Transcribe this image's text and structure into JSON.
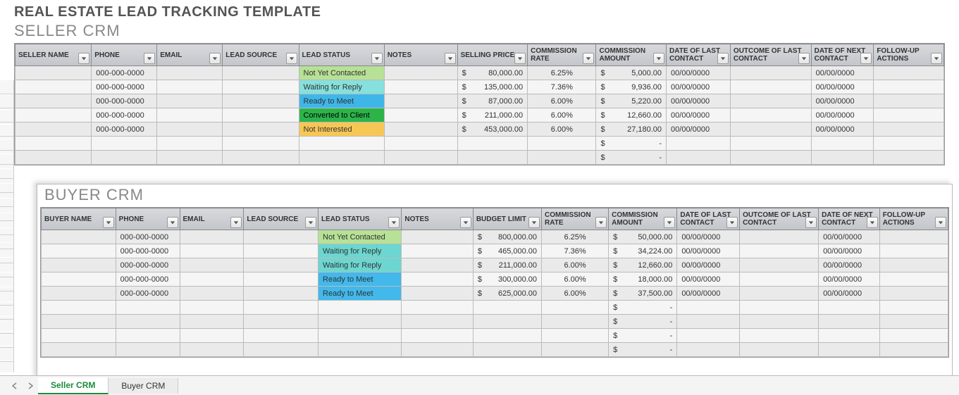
{
  "title": "REAL ESTATE LEAD TRACKING TEMPLATE",
  "seller": {
    "label": "SELLER CRM",
    "columns": [
      "SELLER NAME",
      "PHONE",
      "EMAIL",
      "LEAD SOURCE",
      "LEAD STATUS",
      "NOTES",
      "SELLING PRICE",
      "COMMISSION RATE",
      "COMMISSION AMOUNT",
      "DATE OF LAST CONTACT",
      "OUTCOME OF LAST CONTACT",
      "DATE OF NEXT CONTACT",
      "FOLLOW-UP ACTIONS"
    ],
    "rows": [
      {
        "phone": "000-000-0000",
        "status": "Not Yet Contacted",
        "status_cls": "st-notyet",
        "price": "80,000.00",
        "rate": "6.25%",
        "amount": "5,000.00",
        "dlast": "00/00/0000",
        "dnext": "00/00/0000"
      },
      {
        "phone": "000-000-0000",
        "status": "Waiting for Reply",
        "status_cls": "st-waiting-s",
        "price": "135,000.00",
        "rate": "7.36%",
        "amount": "9,936.00",
        "dlast": "00/00/0000",
        "dnext": "00/00/0000"
      },
      {
        "phone": "000-000-0000",
        "status": "Ready to Meet",
        "status_cls": "st-ready-s",
        "price": "87,000.00",
        "rate": "6.00%",
        "amount": "5,220.00",
        "dlast": "00/00/0000",
        "dnext": "00/00/0000"
      },
      {
        "phone": "000-000-0000",
        "status": "Converted to Client",
        "status_cls": "st-convert",
        "price": "211,000.00",
        "rate": "6.00%",
        "amount": "12,660.00",
        "dlast": "00/00/0000",
        "dnext": "00/00/0000"
      },
      {
        "phone": "000-000-0000",
        "status": "Not Interested",
        "status_cls": "st-notint",
        "price": "453,000.00",
        "rate": "6.00%",
        "amount": "27,180.00",
        "dlast": "00/00/0000",
        "dnext": "00/00/0000"
      },
      {
        "phone": "",
        "status": "",
        "status_cls": "",
        "price": "",
        "rate": "",
        "amount": "-",
        "dlast": "",
        "dnext": ""
      },
      {
        "phone": "",
        "status": "",
        "status_cls": "",
        "price": "",
        "rate": "",
        "amount": "-",
        "dlast": "",
        "dnext": ""
      }
    ]
  },
  "buyer": {
    "label": "BUYER CRM",
    "columns": [
      "BUYER NAME",
      "PHONE",
      "EMAIL",
      "LEAD SOURCE",
      "LEAD STATUS",
      "NOTES",
      "BUDGET LIMIT",
      "COMMISSION RATE",
      "COMMISSION AMOUNT",
      "DATE OF LAST CONTACT",
      "OUTCOME OF LAST CONTACT",
      "DATE OF NEXT CONTACT",
      "FOLLOW-UP ACTIONS"
    ],
    "rows": [
      {
        "phone": "000-000-0000",
        "status": "Not Yet Contacted",
        "status_cls": "st-notyet",
        "price": "800,000.00",
        "rate": "6.25%",
        "amount": "50,000.00",
        "dlast": "00/00/0000",
        "dnext": "00/00/0000"
      },
      {
        "phone": "000-000-0000",
        "status": "Waiting for Reply",
        "status_cls": "st-waiting-b",
        "price": "465,000.00",
        "rate": "7.36%",
        "amount": "34,224.00",
        "dlast": "00/00/0000",
        "dnext": "00/00/0000"
      },
      {
        "phone": "000-000-0000",
        "status": "Waiting for Reply",
        "status_cls": "st-waiting-b",
        "price": "211,000.00",
        "rate": "6.00%",
        "amount": "12,660.00",
        "dlast": "00/00/0000",
        "dnext": "00/00/0000"
      },
      {
        "phone": "000-000-0000",
        "status": "Ready to Meet",
        "status_cls": "st-ready-b",
        "price": "300,000.00",
        "rate": "6.00%",
        "amount": "18,000.00",
        "dlast": "00/00/0000",
        "dnext": "00/00/0000"
      },
      {
        "phone": "000-000-0000",
        "status": "Ready to Meet",
        "status_cls": "st-ready-b",
        "price": "625,000.00",
        "rate": "6.00%",
        "amount": "37,500.00",
        "dlast": "00/00/0000",
        "dnext": "00/00/0000"
      },
      {
        "phone": "",
        "status": "",
        "status_cls": "",
        "price": "",
        "rate": "",
        "amount": "-",
        "dlast": "",
        "dnext": ""
      },
      {
        "phone": "",
        "status": "",
        "status_cls": "",
        "price": "",
        "rate": "",
        "amount": "-",
        "dlast": "",
        "dnext": ""
      },
      {
        "phone": "",
        "status": "",
        "status_cls": "",
        "price": "",
        "rate": "",
        "amount": "-",
        "dlast": "",
        "dnext": ""
      },
      {
        "phone": "",
        "status": "",
        "status_cls": "",
        "price": "",
        "rate": "",
        "amount": "-",
        "dlast": "",
        "dnext": ""
      }
    ]
  },
  "tabs": {
    "seller": "Seller CRM",
    "buyer": "Buyer CRM"
  }
}
